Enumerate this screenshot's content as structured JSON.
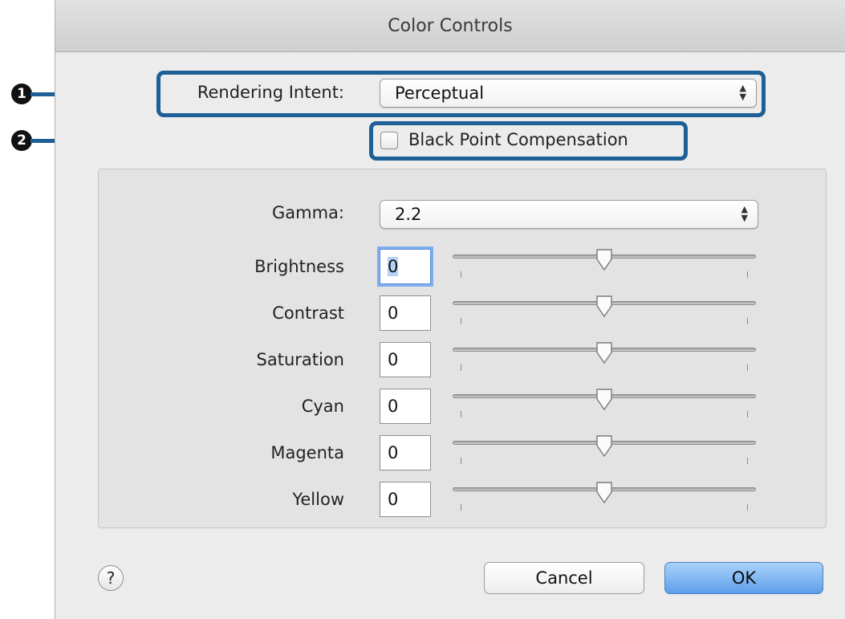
{
  "window": {
    "title": "Color Controls"
  },
  "callouts": [
    "1",
    "2"
  ],
  "rendering_intent": {
    "label": "Rendering Intent:",
    "value": "Perceptual"
  },
  "black_point": {
    "label": "Black Point Compensation",
    "checked": false
  },
  "gamma": {
    "label": "Gamma:",
    "value": "2.2"
  },
  "sliders": [
    {
      "label": "Brightness",
      "value": "0",
      "position": 0.5
    },
    {
      "label": "Contrast",
      "value": "0",
      "position": 0.5
    },
    {
      "label": "Saturation",
      "value": "0",
      "position": 0.5
    },
    {
      "label": "Cyan",
      "value": "0",
      "position": 0.5
    },
    {
      "label": "Magenta",
      "value": "0",
      "position": 0.5
    },
    {
      "label": "Yellow",
      "value": "0",
      "position": 0.5
    }
  ],
  "buttons": {
    "help": "?",
    "cancel": "Cancel",
    "ok": "OK"
  },
  "colors": {
    "callout": "#1d5f97",
    "ok_button": "#5d9fe9",
    "focus_ring": "#7eaef0"
  }
}
